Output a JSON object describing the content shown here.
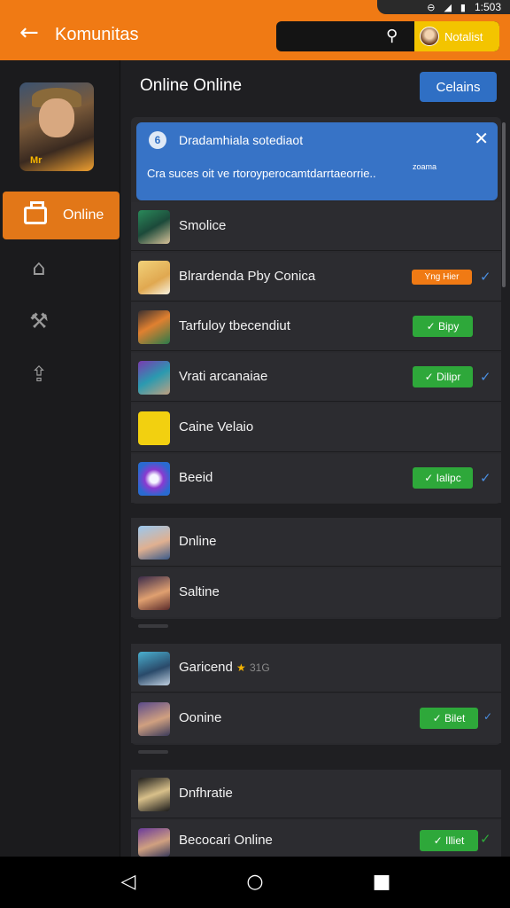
{
  "status": {
    "time": "1:503"
  },
  "app": {
    "title": "Komunitas",
    "notify_label": "Notalist"
  },
  "sidebar": {
    "hero_badge": "Mr",
    "items": [
      {
        "label": "Online",
        "icon": "briefcase-icon",
        "active": true
      },
      {
        "icon": "gallery-icon"
      },
      {
        "icon": "tools-icon"
      },
      {
        "icon": "upload-lock-icon"
      }
    ]
  },
  "main": {
    "title": "Online Online",
    "action_label": "Celains",
    "notice": {
      "icon_text": "6",
      "title": "Dradamhiala sotediaot",
      "body": "Cra suces oit ve rtoroyperocamtdarrtaeorrie..",
      "small": "zoama"
    },
    "group1": [
      {
        "name": "Smolice",
        "badge": null
      },
      {
        "name": "Blrardenda Pby Conica",
        "badge": {
          "text": "Yng Hier",
          "color": "orange"
        },
        "check": true
      },
      {
        "name": "Tarfuloy tbecendiut",
        "badge": {
          "text": "✓ Bipy",
          "color": "green"
        },
        "check": false
      },
      {
        "name": "Vrati arcanaiae",
        "badge": {
          "text": "✓ Dilipr",
          "color": "green"
        },
        "check": true
      },
      {
        "name": "Caine Velaio",
        "badge": null
      },
      {
        "name": "Beeid",
        "badge": {
          "text": "✓ Ialipc",
          "color": "green"
        },
        "check": true
      }
    ],
    "group2": [
      {
        "name": "Dnline"
      },
      {
        "name": "Saltine"
      }
    ],
    "group3": [
      {
        "name": "Garicend",
        "extra": "31G"
      },
      {
        "name": "Oonine",
        "badge": {
          "text": "✓ Bilet"
        },
        "check": true
      }
    ],
    "group4": [
      {
        "name": "Dnfhratie"
      },
      {
        "name": "Becocari Online",
        "badge": {
          "text": "✓ Illiet"
        },
        "check": true
      }
    ]
  },
  "colors": {
    "accent": "#f07a14",
    "blue": "#3773c6",
    "green": "#2ea83a"
  }
}
